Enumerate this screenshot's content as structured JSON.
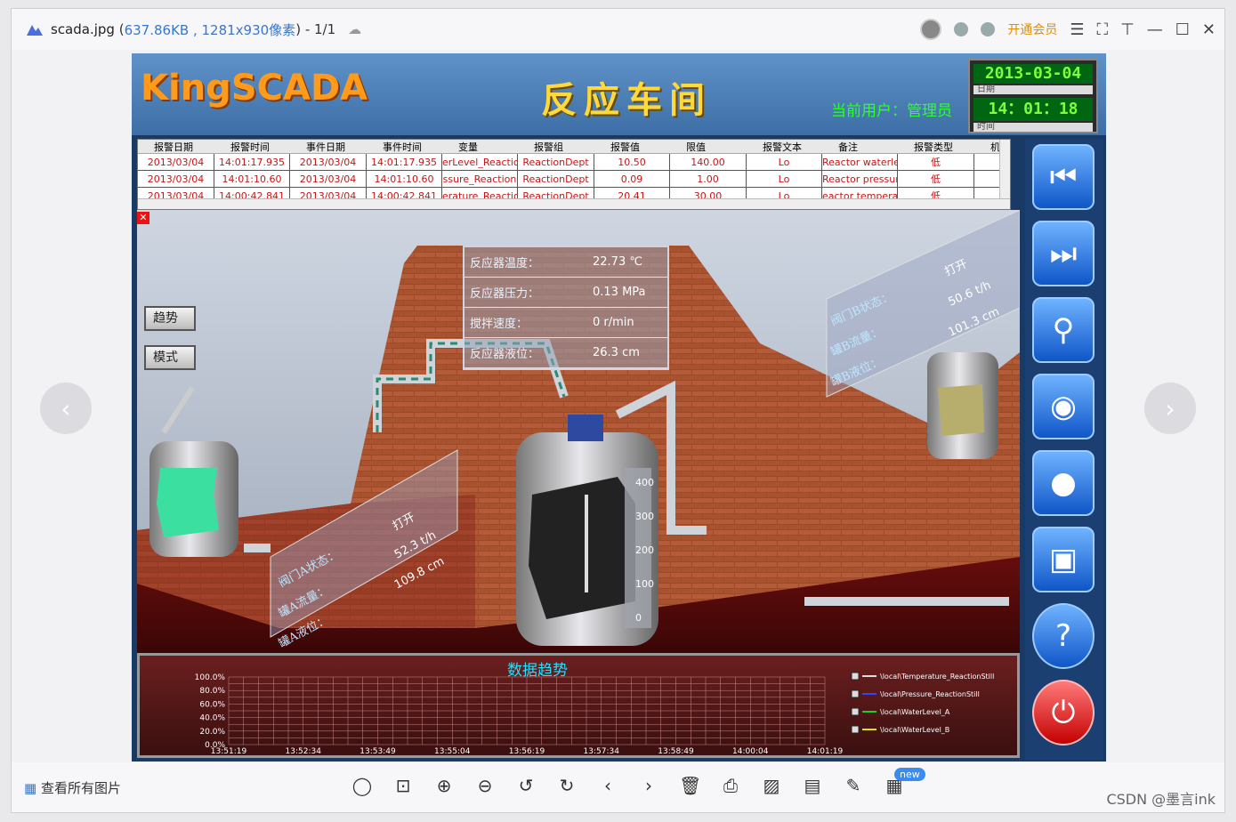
{
  "window": {
    "file_name": "scada.jpg",
    "file_meta": "637.86KB , 1281x930像素",
    "page_counter": "- 1/1",
    "vip_label": "开通会员"
  },
  "scada": {
    "brand": "KingSCADA",
    "workshop": "反应车间",
    "user_label": "当前用户：管理员",
    "date": "2013-03-04",
    "date_caption": "日期",
    "time": "14：01：18",
    "time_caption": "时间"
  },
  "alarm_table": {
    "headers": [
      "报警日期",
      "报警时间",
      "事件日期",
      "事件时间",
      "变量",
      "报警组",
      "报警值",
      "限值",
      "报警文本",
      "备注",
      "报警类型",
      "机"
    ],
    "rows": [
      [
        "2013/03/04",
        "14:01:17.935",
        "2013/03/04",
        "14:01:17.935",
        "erLevel_Reactior",
        "ReactionDept",
        "10.50",
        "140.00",
        "Lo",
        "Reactor waterleve",
        "低"
      ],
      [
        "2013/03/04",
        "14:01:10.60",
        "2013/03/04",
        "14:01:10.60",
        "ssure_Reaction",
        "ReactionDept",
        "0.09",
        "1.00",
        "Lo",
        "Reactor pressure",
        "低"
      ],
      [
        "2013/03/04",
        "14:00:42.841",
        "2013/03/04",
        "14:00:42.841",
        "erature_Reactio",
        "ReactionDept",
        "20.41",
        "30.00",
        "Lo",
        "eactor temperatu",
        "低"
      ]
    ]
  },
  "side_buttons": {
    "trend": "趋势",
    "mode": "模式"
  },
  "reactor": {
    "rows": [
      {
        "label": "反应器温度：",
        "value": "22.73 ℃"
      },
      {
        "label": "反应器压力：",
        "value": "0.13 MPa"
      },
      {
        "label": "搅拌速度：",
        "value": "0 r/min"
      },
      {
        "label": "反应器液位：",
        "value": "26.3 cm"
      }
    ],
    "scale_marks": [
      "400",
      "300",
      "200",
      "100",
      "0"
    ]
  },
  "tank_a": {
    "status_label": "阀门A状态：",
    "status": "打开",
    "flow_label": "罐A流量：",
    "flow": "52.3 t/h",
    "level_label": "罐A液位：",
    "level": "109.8 cm"
  },
  "tank_b": {
    "status_label": "阀门B状态：",
    "status": "打开",
    "flow_label": "罐B流量：",
    "flow": "50.6 t/h",
    "level_label": "罐B液位：",
    "level": "101.3 cm"
  },
  "chart_data": {
    "type": "line",
    "title": "数据趋势",
    "y_ticks": [
      "100.0%",
      "80.0%",
      "60.0%",
      "40.0%",
      "20.0%",
      "0.0%"
    ],
    "x_ticks": [
      "13:51:19",
      "13:52:34",
      "13:53:49",
      "13:55:04",
      "13:56:19",
      "13:57:34",
      "13:58:49",
      "14:00:04",
      "14:01:19"
    ],
    "series": [
      {
        "name": "\\local\\Temperature_ReactionStill",
        "color": "#dddddd"
      },
      {
        "name": "\\local\\Pressure_ReactionStill",
        "color": "#3344ff"
      },
      {
        "name": "\\local\\WaterLevel_A",
        "color": "#22cc22"
      },
      {
        "name": "\\local\\WaterLevel_B",
        "color": "#dddd22"
      }
    ]
  },
  "bottom": {
    "see_all": "查看所有图片",
    "new_badge": "new",
    "watermark": "CSDN @墨言ink"
  },
  "colors": {
    "accent_blue": "#3a77c8",
    "alarm_red": "#c41616",
    "lcd_green": "#7bff3a"
  }
}
